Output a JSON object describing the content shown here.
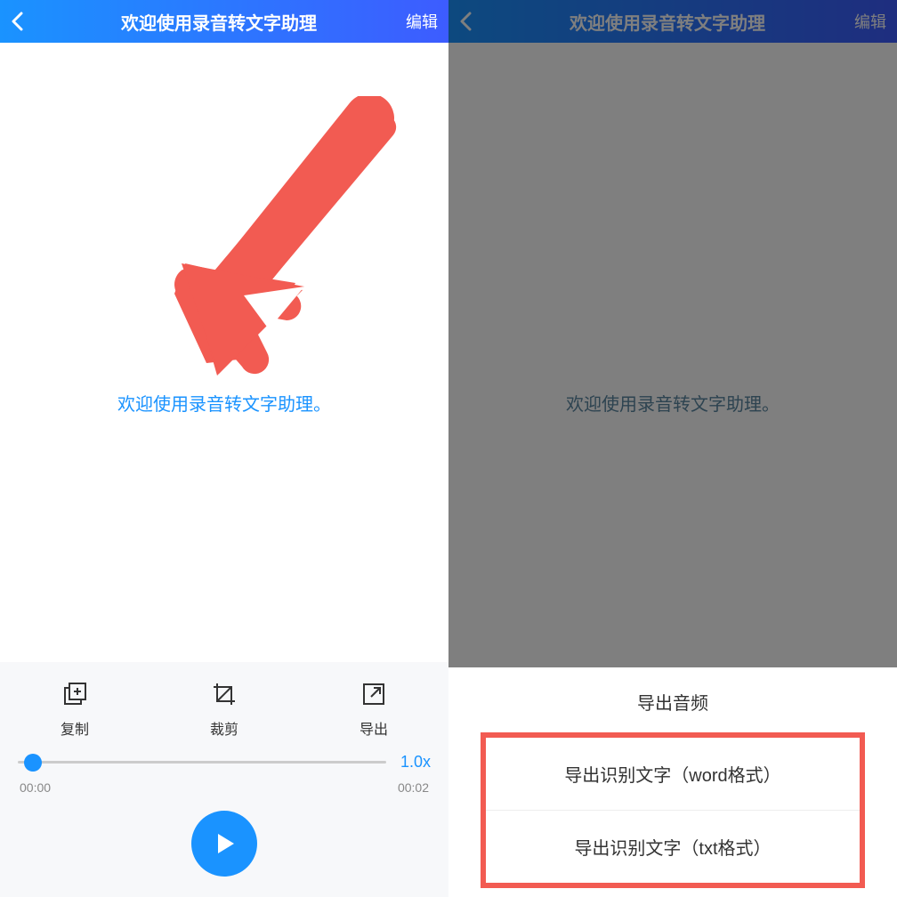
{
  "header": {
    "title": "欢迎使用录音转文字助理",
    "edit": "编辑"
  },
  "content": {
    "welcome": "欢迎使用录音转文字助理。"
  },
  "toolbar": {
    "copy": "复制",
    "crop": "裁剪",
    "export": "导出"
  },
  "player": {
    "speed": "1.0x",
    "time_current": "00:00",
    "time_total": "00:02"
  },
  "sheet": {
    "title": "导出音频",
    "opt_word": "导出识别文字（word格式）",
    "opt_txt": "导出识别文字（txt格式）"
  }
}
